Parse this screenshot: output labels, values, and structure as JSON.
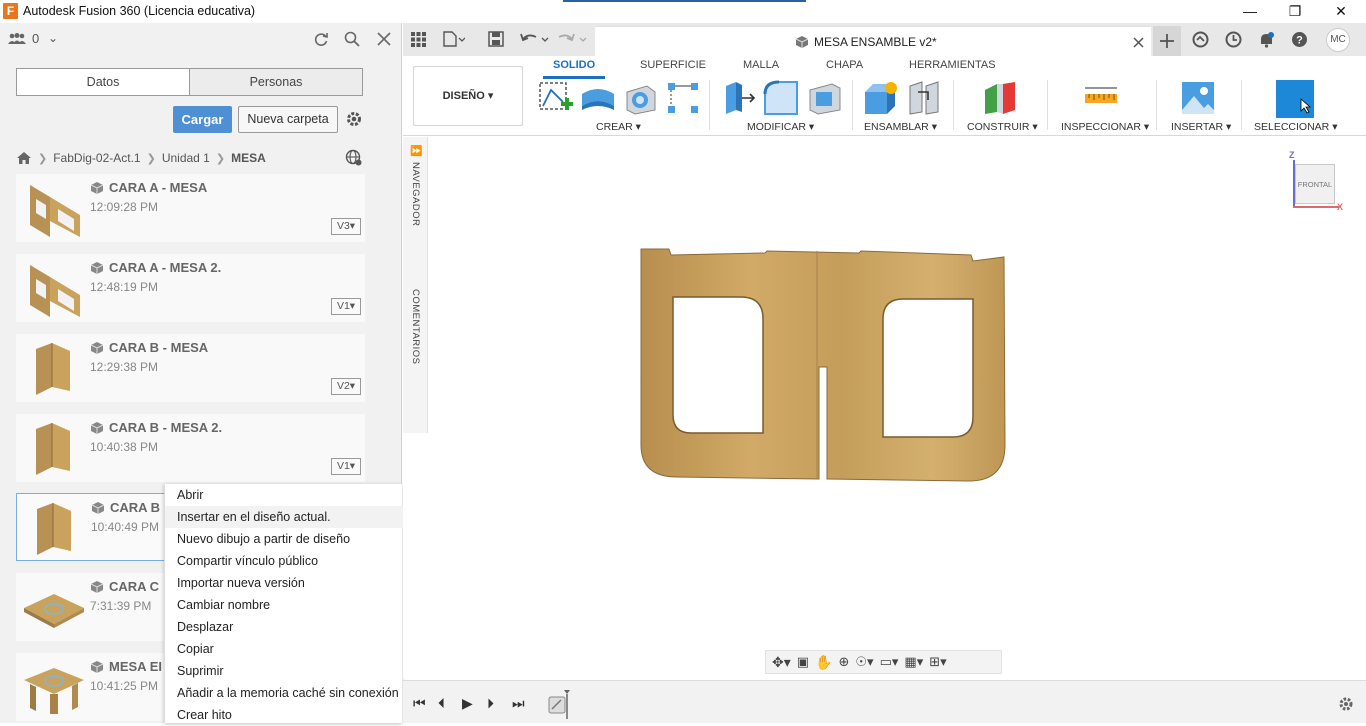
{
  "window": {
    "title": "Autodesk Fusion 360 (Licencia educativa)",
    "app_icon_letter": "F"
  },
  "left_panel": {
    "team_count": "0",
    "segments": [
      "Datos",
      "Personas"
    ],
    "upload_label": "Cargar",
    "new_folder_label": "Nueva carpeta",
    "breadcrumb": [
      "FabDig-02-Act.1",
      "Unidad 1",
      "MESA"
    ],
    "items": [
      {
        "name": "CARA A - MESA",
        "time": "12:09:28 PM",
        "version": "V3",
        "thumb": "panel-a-icon"
      },
      {
        "name": "CARA A - MESA 2.",
        "time": "12:48:19 PM",
        "version": "V1",
        "thumb": "panel-a-icon"
      },
      {
        "name": "CARA B - MESA",
        "time": "12:29:38 PM",
        "version": "V2",
        "thumb": "panel-b-icon"
      },
      {
        "name": "CARA B - MESA 2.",
        "time": "10:40:38 PM",
        "version": "V1",
        "thumb": "panel-b-icon"
      },
      {
        "name": "CARA B",
        "time": "10:40:49 PM",
        "version": "",
        "thumb": "panel-b-icon"
      },
      {
        "name": "CARA C",
        "time": "7:31:39 PM",
        "version": "",
        "thumb": "tabletop-icon"
      },
      {
        "name": "MESA EI",
        "time": "10:41:25 PM",
        "version": "",
        "thumb": "table-assembly-icon"
      }
    ]
  },
  "context_menu": {
    "items": [
      "Abrir",
      "Insertar en el diseño actual.",
      "Nuevo dibujo a partir de diseño",
      "Compartir vínculo público",
      "Importar nueva versión",
      "Cambiar nombre",
      "Desplazar",
      "Copiar",
      "Suprimir",
      "Añadir a la memoria caché sin conexión",
      "Crear hito"
    ],
    "hover_index": 1
  },
  "document": {
    "tab_title": "MESA ENSAMBLE v2*",
    "user_initials": "MC"
  },
  "toolbar": {
    "workspace": "DISEÑO",
    "tabs": [
      "SOLIDO",
      "SUPERFICIE",
      "MALLA",
      "CHAPA",
      "HERRAMIENTAS"
    ],
    "groups": [
      "CREAR",
      "MODIFICAR",
      "ENSAMBLAR",
      "CONSTRUIR",
      "INSPECCIONAR",
      "INSERTAR",
      "SELECCIONAR"
    ]
  },
  "browser_strip": {
    "navigator": "NAVEGADOR",
    "comments": "COMENTARIOS"
  },
  "viewcube": {
    "face": "FRONTAL",
    "axis_z": "Z",
    "axis_x": "X"
  },
  "colors": {
    "accent_blue": "#1d6fc2",
    "upload_blue": "#4f8fd4",
    "wood": "#c9a35e",
    "select_tool": "#1e88d8"
  }
}
